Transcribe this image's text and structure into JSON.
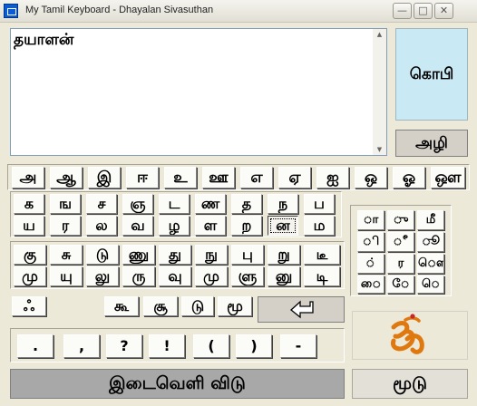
{
  "window": {
    "title": "My Tamil Keyboard - Dhayalan Sivasuthan"
  },
  "editor": {
    "text": "தயாளன்"
  },
  "buttons": {
    "copy": "கொபி",
    "erase": "அழி",
    "space": "இடைவெளி விடு",
    "close": "மூடு"
  },
  "vowels": [
    "அ",
    "ஆ",
    "இ",
    "ஈ",
    "உ",
    "ஊ",
    "எ",
    "ஏ",
    "ஐ",
    "ஒ",
    "ஓ",
    "ஔ"
  ],
  "consonants_row1": [
    "க",
    "ங",
    "ச",
    "ஞ",
    "ட",
    "ண",
    "த",
    "ந",
    "ப"
  ],
  "consonants_row2": [
    "ய",
    "ர",
    "ல",
    "வ",
    "ழ",
    "ள",
    "ற",
    "ன",
    "ம"
  ],
  "u_row1": [
    "கு",
    "சு",
    "டு",
    "ணு",
    "து",
    "நு",
    "பு",
    "று",
    "டீ"
  ],
  "u_row2": [
    "மு",
    "யு",
    "லு",
    "ரு",
    "வு",
    "மு",
    "ளு",
    "னு",
    "டி"
  ],
  "aytham": "ஃ",
  "uu_keys": [
    "கூ",
    "சூ",
    "டு",
    "மூ"
  ],
  "signs": [
    "ா",
    "ு",
    "மீ",
    "ி",
    "ீ",
    "ூ",
    "்",
    "ர",
    "ௌ",
    "ை",
    "ே",
    "ெ"
  ],
  "punctuation": [
    ".",
    ",",
    "?",
    "!",
    "(",
    ")",
    "-"
  ],
  "icons": {
    "enter": "enter-arrow-icon",
    "om": "om-symbol-icon"
  }
}
